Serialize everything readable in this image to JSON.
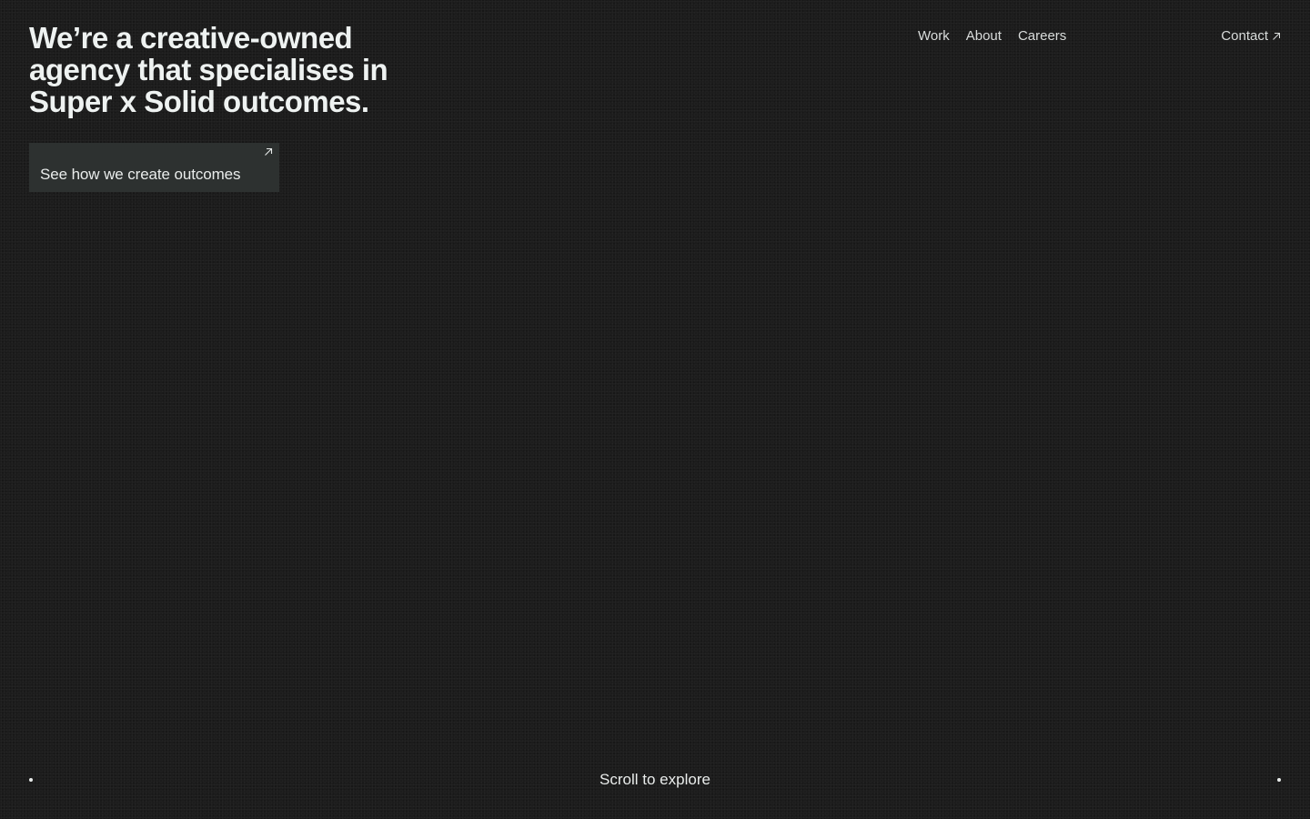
{
  "hero": {
    "headline": "We’re a creative-owned agency that specialises in Super x Solid outcomes.",
    "cta_label": "See how we create outcomes",
    "cta_icon": "arrow-up-right-icon"
  },
  "nav": {
    "items": [
      {
        "label": "Work"
      },
      {
        "label": "About"
      },
      {
        "label": "Careers"
      }
    ],
    "contact_label": "Contact",
    "contact_icon": "arrow-up-right-icon"
  },
  "footer": {
    "scroll_label": "Scroll to explore"
  },
  "colors": {
    "background": "#1c1c1c",
    "text": "#e9eceb",
    "button_background": "#2d3130"
  }
}
